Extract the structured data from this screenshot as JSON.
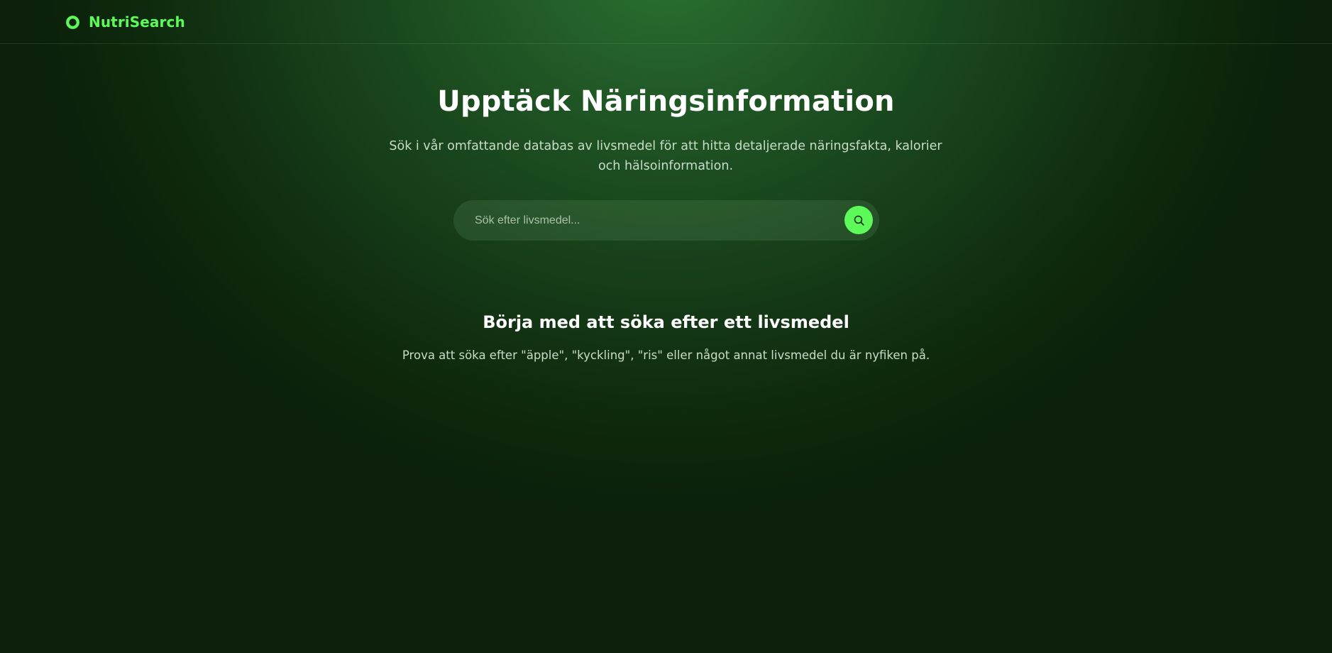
{
  "header": {
    "brand_name": "NutriSearch",
    "logo_icon": "ring-logo-icon"
  },
  "hero": {
    "title": "Upptäck Näringsinformation",
    "subtitle": "Sök i vår omfattande databas av livsmedel för att hitta detaljerade näringsfakta, kalorier och hälsoinformation."
  },
  "search": {
    "placeholder": "Sök efter livsmedel...",
    "value": "",
    "button_icon": "search-icon"
  },
  "empty_state": {
    "title": "Börja med att söka efter ett livsmedel",
    "hint": "Prova att söka efter \"äpple\", \"kyckling\", \"ris\" eller något annat livsmedel du är nyfiken på."
  },
  "colors": {
    "accent": "#5dfb5a",
    "background_dark": "#0b1f0a",
    "background_glow": "#2a7331",
    "text_muted": "#c8dcc8"
  }
}
